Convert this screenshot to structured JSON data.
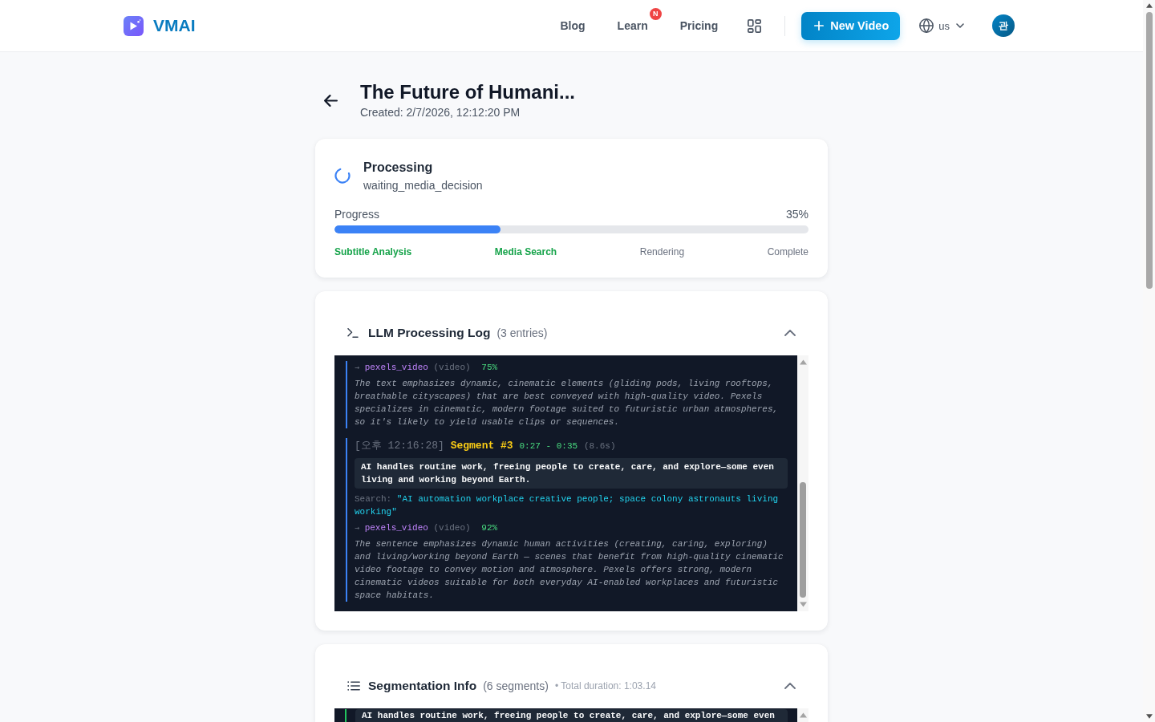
{
  "header": {
    "brand": "VMAI",
    "nav": [
      {
        "label": "Blog"
      },
      {
        "label": "Learn",
        "badge": "N"
      },
      {
        "label": "Pricing"
      }
    ],
    "new_video": "New Video",
    "language": "us",
    "avatar": "관"
  },
  "video": {
    "title": "The Future of Humani...",
    "created": "Created: 2/7/2026, 12:12:20 PM"
  },
  "status": {
    "title": "Processing",
    "stage": "waiting_media_decision",
    "progress_label": "Progress",
    "progress_value": "35%",
    "level": 0.35,
    "steps": [
      {
        "label": "Subtitle Analysis",
        "done": true
      },
      {
        "label": "Media Search",
        "done": true
      },
      {
        "label": "Rendering",
        "done": false
      },
      {
        "label": "Complete",
        "done": false
      }
    ]
  },
  "llm_log": {
    "title": "LLM Processing Log",
    "count": "(3 entries)",
    "expanded": true,
    "entries": [
      {
        "result": {
          "arrow": "→",
          "source": "pexels_video",
          "type": "(video)",
          "score": "75%"
        },
        "reasoning": "The text emphasizes dynamic, cinematic elements (gliding pods, living rooftops, breathable cityscapes) that are best conveyed with high-quality video. Pexels specializes in cinematic, modern footage suited to futuristic urban atmospheres, so it's likely to yield usable clips or sequences."
      },
      {
        "time": "[오후 12:16:28]",
        "segment": "Segment #3",
        "range": "0:27 - 0:35",
        "duration": "(8.6s)",
        "text": "AI handles routine work, freeing people to create, care, and explore—some even living and working beyond Earth.",
        "search_label": "Search:",
        "query": "\"AI automation workplace creative people; space colony astronauts living working\"",
        "result": {
          "arrow": "→",
          "source": "pexels_video",
          "type": "(video)",
          "score": "92%"
        },
        "reasoning": "The sentence emphasizes dynamic human activities (creating, caring, exploring) and living/working beyond Earth — scenes that benefit from high-quality cinematic video footage to convey motion and atmosphere. Pexels offers strong, modern cinematic videos suitable for both everyday AI-enabled workplaces and futuristic space habitats."
      }
    ]
  },
  "segmentation": {
    "title": "Segmentation Info",
    "count": "(6 segments)",
    "total": "• Total duration: 1:03.14",
    "expanded": true,
    "segments": [
      {
        "text": "AI handles routine work, freeing people to create, care, and explore—some even"
      }
    ]
  }
}
